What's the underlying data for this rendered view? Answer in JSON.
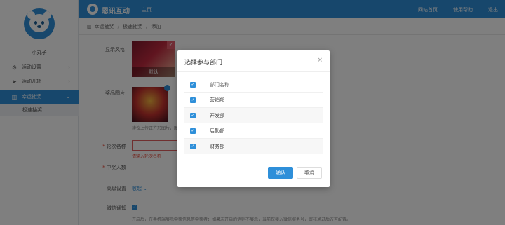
{
  "sidebar": {
    "username": "小丸子",
    "items": [
      {
        "label": "活动设置",
        "icon": "sliders-icon",
        "chevron": "›"
      },
      {
        "label": "活动开场",
        "icon": "send-icon",
        "chevron": "›"
      },
      {
        "label": "幸运抽奖",
        "icon": "chart-icon",
        "chevron": "⌄"
      }
    ],
    "sub_item": "极速抽奖"
  },
  "header": {
    "brand": "恩讯互动",
    "home": "主页",
    "links": [
      "网站首页",
      "使用帮助",
      "退出"
    ]
  },
  "breadcrumb": [
    "幸运抽奖",
    "极速抽奖",
    "添加"
  ],
  "form": {
    "display_style_label": "显示风格",
    "banner_badge": "默认",
    "prize_image_label": "奖品图片",
    "prize_hint": "建议上传正方形图片，图片",
    "round_name_label": "轮次名称",
    "round_name_error": "请输入轮次名称",
    "winners_label": "中奖人数",
    "advanced_label": "高级设置",
    "advanced_link": "收起",
    "notify_label": "微信通知",
    "notify_text": "开启后，在手机端展示中奖信息等中奖者；如果未开启的话则不展示，当前仅接入微信服务号，审核通过后方可配置。"
  },
  "modal": {
    "title": "选择参与部门",
    "close": "×",
    "header_col": "部门名称",
    "departments": [
      "营销部",
      "开发部",
      "后勤部",
      "财务部"
    ],
    "confirm": "确认",
    "cancel": "取消"
  },
  "colors": {
    "primary": "#2e8fd9",
    "error": "#e74c3c"
  }
}
